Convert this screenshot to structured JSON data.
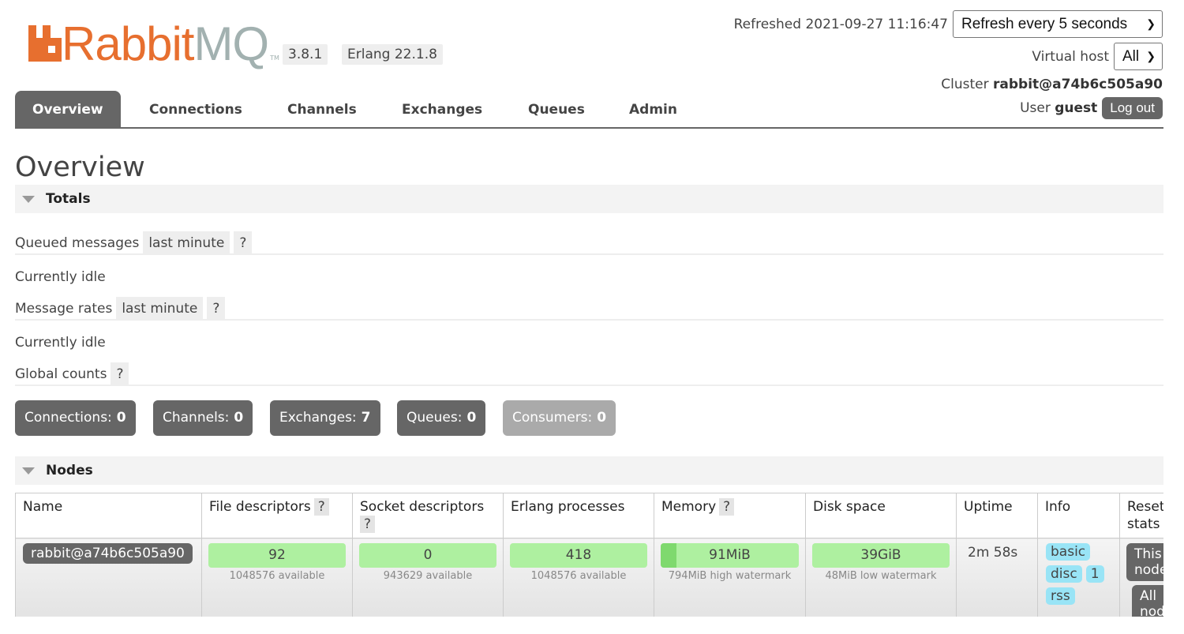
{
  "header": {
    "logo": {
      "word_primary": "Rabbit",
      "word_secondary": "MQ",
      "trademark": "TM"
    },
    "version": "3.8.1",
    "erlang_version": "Erlang 22.1.8",
    "refreshed": "Refreshed 2021-09-27 11:16:47",
    "refresh_select": {
      "value": "Refresh every 5 seconds"
    },
    "virtual_host": {
      "label": "Virtual host",
      "value": "All"
    },
    "cluster": {
      "label": "Cluster",
      "name": "rabbit@a74b6c505a90"
    },
    "user": {
      "label": "User",
      "name": "guest",
      "logout_label": "Log out"
    }
  },
  "nav": {
    "tabs": [
      {
        "label": "Overview",
        "active": true
      },
      {
        "label": "Connections"
      },
      {
        "label": "Channels"
      },
      {
        "label": "Exchanges"
      },
      {
        "label": "Queues"
      },
      {
        "label": "Admin"
      }
    ]
  },
  "page": {
    "title": "Overview"
  },
  "totals": {
    "heading": "Totals",
    "queued_messages": {
      "label": "Queued messages",
      "range": "last minute",
      "help": "?",
      "status": "Currently idle"
    },
    "message_rates": {
      "label": "Message rates",
      "range": "last minute",
      "help": "?",
      "status": "Currently idle"
    },
    "global_counts": {
      "label": "Global counts",
      "help": "?"
    },
    "counts": [
      {
        "label": "Connections:",
        "value": "0"
      },
      {
        "label": "Channels:",
        "value": "0"
      },
      {
        "label": "Exchanges:",
        "value": "7"
      },
      {
        "label": "Queues:",
        "value": "0"
      },
      {
        "label": "Consumers:",
        "value": "0"
      }
    ]
  },
  "nodes": {
    "heading": "Nodes",
    "columns": [
      "Name",
      "File descriptors",
      "Socket descriptors",
      "Erlang processes",
      "Memory",
      "Disk space",
      "Uptime",
      "Info",
      "Reset stats"
    ],
    "help": "?",
    "rows": [
      {
        "name": "rabbit@a74b6c505a90",
        "file_descriptors": {
          "value": "92",
          "sub": "1048576 available"
        },
        "socket_descriptors": {
          "value": "0",
          "sub": "943629 available"
        },
        "erlang_processes": {
          "value": "418",
          "sub": "1048576 available"
        },
        "memory": {
          "value": "91MiB",
          "sub": "794MiB high watermark",
          "used_fraction": 0.115
        },
        "disk_space": {
          "value": "39GiB",
          "sub": "48MiB low watermark"
        },
        "uptime": "2m 58s",
        "info": [
          "basic",
          "disc",
          "1",
          "rss"
        ],
        "reset": [
          "This node",
          "All nodes"
        ]
      }
    ]
  },
  "colors": {
    "brand_orange": "#e76f2f",
    "brand_grey": "#a2b1b0",
    "ok_green": "#aef0a0",
    "info_blue": "#99e4f6",
    "button_grey": "#666666"
  }
}
